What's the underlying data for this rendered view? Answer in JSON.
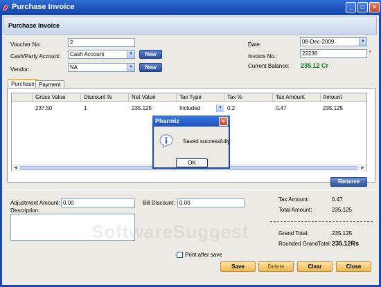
{
  "window": {
    "title": "Purchase Invoice"
  },
  "header": {
    "title": "Purchase Invoice"
  },
  "form": {
    "voucher_no_label": "Voucher No:",
    "voucher_no_value": "2",
    "cash_party_label": "Cash/Party Account:",
    "cash_party_value": "Cash Account",
    "vendor_label": "Vendor:",
    "vendor_value": "NA",
    "new_label": "New",
    "date_label": "Date:",
    "date_value": "08-Dec-2009",
    "invoice_no_label": "Invoice No.:",
    "invoice_no_value": "22236",
    "current_balance_label": "Current Balance:",
    "current_balance_value": "235.12 Cr"
  },
  "tabs": [
    {
      "label": "Purchase",
      "active": true
    },
    {
      "label": "Payment",
      "active": false
    }
  ],
  "grid": {
    "columns": [
      "Gross Value",
      "Discount %",
      "Net Value",
      "Tax Type",
      "Tax %",
      "Tax Amount",
      "Amount"
    ],
    "rows": [
      {
        "gross_value": "237.50",
        "discount": "1",
        "net_value": "235.125",
        "tax_type": "Included",
        "tax_pct": "0.2",
        "tax_amount": "0.47",
        "amount": "235.125"
      }
    ]
  },
  "remove_label": "Remove",
  "bottom": {
    "adjustment_label": "Adjustment Amount:",
    "adjustment_value": "0.00",
    "description_label": "Description:",
    "bill_discount_label": "Bill Discount:",
    "bill_discount_value": "0.00",
    "tax_amount_label": "Tax Amount:",
    "tax_amount_value": "0.47",
    "total_amount_label": "Total Amount:",
    "total_amount_value": "235.125",
    "grand_total_label": "Grand Total:",
    "grand_total_value": "235.125",
    "rounded_label": "Rounded GrandTotal:",
    "rounded_value": "235.12Rs",
    "print_after_save_label": "Print after save"
  },
  "actions": {
    "save": "Save",
    "delete": "Delete",
    "clear": "Clear",
    "close": "Close"
  },
  "dialog": {
    "title": "Pharmiz",
    "message": "Saved successfully",
    "ok_label": "OK"
  },
  "watermark": "SoftwareSuggest",
  "colors": {
    "titlebar": "#1c4fb8",
    "balance_green": "#0a7a2a",
    "action_orange": "#f5b74d"
  }
}
